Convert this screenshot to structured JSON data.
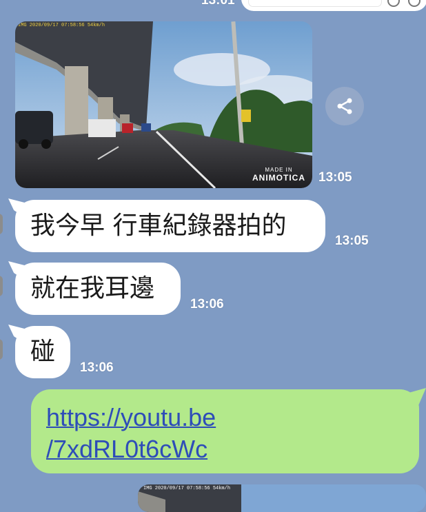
{
  "colors": {
    "chat_background": "#7f9bc4",
    "incoming_bubble": "#ffffff",
    "outgoing_bubble": "#b3e98b",
    "link": "#2e4db8",
    "timestamp": "#ffffff"
  },
  "top_partial": {
    "time": "13:01"
  },
  "video_message": {
    "dashcam_stamp": "IMG  2020/09/17  07:58:56  54km/h",
    "watermark_small": "MADE IN",
    "watermark_big": "ANIMOTICA",
    "time": "13:05",
    "share_icon": "share-icon"
  },
  "messages": [
    {
      "text": "我今早 行車紀錄器拍的",
      "time": "13:05"
    },
    {
      "text": "就在我耳邊",
      "time": "13:06"
    },
    {
      "text": "碰",
      "time": "13:06"
    }
  ],
  "outgoing_link": {
    "line1": "https://youtu.be",
    "line2": "/7xdRL0t6cWc"
  },
  "bottom_partial_video": {
    "dashcam_stamp": "IMG  2020/09/17  07:58:56  54km/h"
  }
}
